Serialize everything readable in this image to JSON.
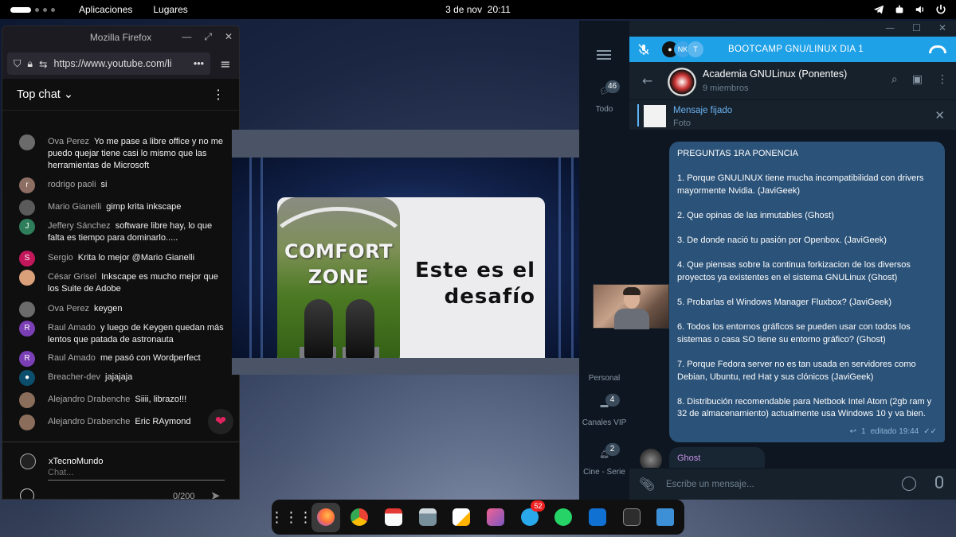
{
  "topbar": {
    "apps_menu": "Aplicaciones",
    "places_menu": "Lugares",
    "date": "3 de nov",
    "time": "20:11"
  },
  "firefox": {
    "window_title": "Mozilla Firefox",
    "url": "https://www.youtube.com/li",
    "url_more": "•••",
    "chat_header": "Top chat",
    "chat_messages": [
      {
        "name": "Ova Perez",
        "text": "Yo me pase a libre office y no me puedo quejar tiene casi lo mismo que las herramientas de Microsoft",
        "avatar_color": "#6b6b6b",
        "initial": ""
      },
      {
        "name": "rodrigo paoli",
        "text": "si",
        "avatar_color": "#8d6e63",
        "initial": "r"
      },
      {
        "name": "Mario Gianelli",
        "text": "gimp krita inkscape",
        "avatar_color": "#5a5a5a",
        "initial": ""
      },
      {
        "name": "Jeffery Sánchez",
        "text": "software libre hay, lo que falta es tiempo para dominarlo.....",
        "avatar_color": "#2e7d5b",
        "initial": "J"
      },
      {
        "name": "Sergio",
        "text": "Krita lo mejor @Mario Gianelli",
        "avatar_color": "#c2185b",
        "initial": "S"
      },
      {
        "name": "César Grisel",
        "text": "Inkscape es mucho mejor que los Suite de Adobe",
        "avatar_color": "#d9a07a",
        "initial": ""
      },
      {
        "name": "Ova Perez",
        "text": "keygen",
        "avatar_color": "#6b6b6b",
        "initial": ""
      },
      {
        "name": "Raul Amado",
        "text": "y luego de Keygen quedan más lentos que patada de astronauta",
        "avatar_color": "#7b3fb5",
        "initial": "R"
      },
      {
        "name": "Raul Amado",
        "text": "me pasó con Wordperfect",
        "avatar_color": "#7b3fb5",
        "initial": "R"
      },
      {
        "name": "Breacher-dev",
        "text": "jajajaja",
        "avatar_color": "#0b4f6c",
        "initial": "●"
      },
      {
        "name": "Alejandro Drabenche",
        "text": "Siiii, librazo!!!",
        "avatar_color": "#8a6d5a",
        "initial": ""
      },
      {
        "name": "Alejandro Drabenche",
        "text": "Eric RAymond",
        "avatar_color": "#8a6d5a",
        "initial": ""
      }
    ],
    "current_user": "xTecnoMundo",
    "chat_placeholder": "Chat...",
    "char_count": "0/200"
  },
  "slide": {
    "comfort_line1": "COMFORT",
    "comfort_line2": "ZONE",
    "line1": "Este es el",
    "line2": "desafío"
  },
  "telegram": {
    "call_title": "BOOTCAMP GNU/LINUX DIA 1",
    "call_avatar_text": "NK",
    "call_avatar_text2": "T",
    "group_name": "Academia GNULinux (Ponentes)",
    "members": "9 miembros",
    "pinned_title": "Mensaje fijado",
    "pinned_sub": "Foto",
    "folders": [
      {
        "label": "Todo",
        "badge": "46"
      },
      {
        "label": "Personal",
        "badge": ""
      },
      {
        "label": "Canales VIP",
        "badge": "4"
      },
      {
        "label": "Cine - Serie",
        "badge": "2"
      }
    ],
    "message_paragraphs": [
      "PREGUNTAS 1RA PONENCIA",
      "1. Porque GNULINUX tiene mucha incompatibilidad con drivers mayormente Nvidia. (JaviGeek)",
      "2. Que opinas de las inmutables (Ghost)",
      "3. De donde nació tu pasión por Openbox. (JaviGeek)",
      "4. Que piensas sobre la continua forkizacion de los diversos proyectos ya existentes en el sistema GNULinux (Ghost)",
      "5. Probarlas el Windows Manager Fluxbox? (JaviGeek)",
      "6. Todos los entornos gráficos se pueden usar con todos los sistemas o casa SO tiene su entorno gráfico? (Ghost)",
      "7. Porque Fedora server no es tan usada en servidores como Debian, Ubuntu, red Hat y sus clónicos (JaviGeek)",
      "8. Distribución recomendable para Netbook Intel Atom (2gb ram y 32 de almacenamiento) actualmente usa Windows 10 y va bien."
    ],
    "reply_count": "1",
    "edited_time": "editado 19:44",
    "next_sender": "Ghost",
    "input_placeholder": "Escribe un mensaje..."
  },
  "dock": {
    "telegram_badge": "52"
  },
  "colors": {
    "telegram_call_bar": "#1fa1e8",
    "telegram_bubble": "#2b5278",
    "badge_red": "#e22222"
  }
}
